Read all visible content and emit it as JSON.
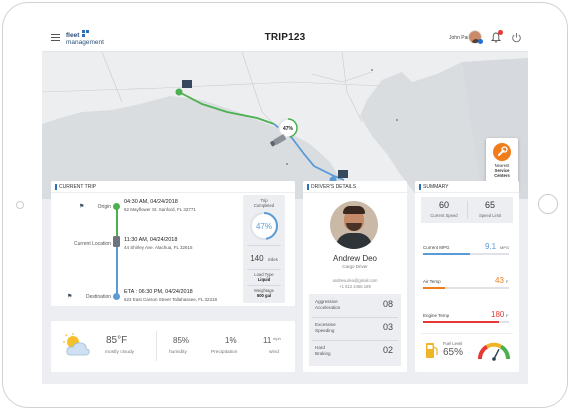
{
  "app": {
    "brand_line1": "fleet",
    "brand_line2": "management",
    "page_title": "TRIP123",
    "user_name": "John Parker"
  },
  "colors": {
    "brand_blue": "#2e6fb6",
    "accent_green": "#4caf50",
    "accent_orange": "#f07c1a",
    "accent_red": "#e53935",
    "route_line": "#5b9bd5"
  },
  "map": {
    "progress_label": "47%",
    "progress_value": 47,
    "service_button_line1": "Nearest",
    "service_button_line2": "Service",
    "service_button_line3": "Centers"
  },
  "current_trip": {
    "heading": "CURRENT TRIP",
    "stops": [
      {
        "label": "Origin",
        "time": "04:30 AM, 04/24/2018",
        "address": "62 Mayflower St. Sanford, FL 32771"
      },
      {
        "label": "Current Location",
        "time": "11:30 AM, 04/24/2018",
        "address": "44 Shirley Ave. Alachua, FL 32615"
      },
      {
        "label": "Destination",
        "time": "ETA : 06:30 PM, 04/24/2018",
        "address": "623 East Carson Street Tallahassee, FL 32318"
      }
    ],
    "panel": {
      "completed_label_1": "Trip",
      "completed_label_2": "Completed",
      "completed_value": "47%",
      "completed_fraction": 0.47,
      "miles_value": "140",
      "miles_unit": "miles",
      "load_type_label": "Load Type",
      "load_type_value": "Liquid",
      "weightage_label": "Weightage",
      "weightage_value": "500 gal"
    }
  },
  "weather": {
    "temp": "85°F",
    "condition": "mostly cloudy",
    "humidity_value": "85%",
    "humidity_label": "humidity",
    "precip_value": "1%",
    "precip_label": "Precipitation",
    "wind_value": "11",
    "wind_unit": "mph",
    "wind_label": "wind"
  },
  "driver": {
    "heading": "DRIVER'S DETAILS",
    "name": "Andrew Deo",
    "role": "Cargo Driver",
    "email": "andrew.deo@gmail.com",
    "phone": "+1 512 2455 189",
    "stats": [
      {
        "label_1": "Aggressive",
        "label_2": "Acceleration",
        "value": "08"
      },
      {
        "label_1": "Excessive",
        "label_2": "Speeding",
        "value": "03"
      },
      {
        "label_1": "Hard",
        "label_2": "Braking",
        "value": "02"
      }
    ]
  },
  "summary": {
    "heading": "SUMMARY",
    "current_speed_value": "60",
    "current_speed_label": "Current Speed",
    "speed_limit_value": "65",
    "speed_limit_label": "Speed Limit",
    "metrics": [
      {
        "label": "Current MPG",
        "value": "9.1",
        "unit": "MPG",
        "color": "#5b9bd5",
        "fraction": 0.55
      },
      {
        "label": "Air Temp",
        "value": "43",
        "unit": "F",
        "color": "#f07c1a",
        "fraction": 0.25
      },
      {
        "label": "Engine Temp",
        "value": "180",
        "unit": "F",
        "color": "#e53935",
        "fraction": 0.88
      }
    ],
    "fuel_label": "Fuel Level",
    "fuel_value": "65%",
    "fuel_fraction": 0.65
  },
  "icons": {
    "menu": "hamburger-icon",
    "bell": "bell-icon",
    "power": "power-icon",
    "wrench": "wrench-icon",
    "truck": "truck-icon",
    "flag": "flag-icon",
    "cloud": "partly-cloudy-icon",
    "fuel": "fuel-pump-icon",
    "gauge": "speedometer-icon"
  }
}
